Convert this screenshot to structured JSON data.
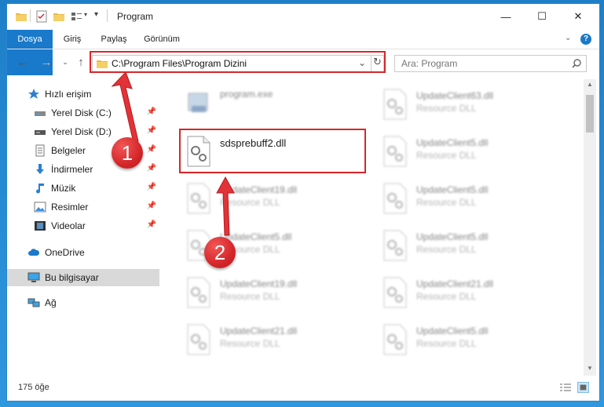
{
  "window": {
    "title": "Program",
    "controls": {
      "minimize": "—",
      "maximize": "☐",
      "close": "✕"
    }
  },
  "ribbon": {
    "tabs": [
      {
        "label": "Dosya",
        "active": true
      },
      {
        "label": "Giriş"
      },
      {
        "label": "Paylaş"
      },
      {
        "label": "Görünüm"
      }
    ],
    "help": "?"
  },
  "address_bar": {
    "path": "C:\\Program Files\\Program Dizini"
  },
  "search": {
    "placeholder": "Ara: Program"
  },
  "nav_pane": {
    "quick_access": "Hızlı erişim",
    "items": [
      {
        "label": "Yerel Disk (C:)",
        "icon": "drive-icon",
        "pinned": true
      },
      {
        "label": "Yerel Disk (D:)",
        "icon": "drive-icon",
        "pinned": true
      },
      {
        "label": "Belgeler",
        "icon": "documents-icon",
        "pinned": true
      },
      {
        "label": "İndirmeler",
        "icon": "downloads-icon",
        "pinned": true
      },
      {
        "label": "Müzik",
        "icon": "music-icon",
        "pinned": true
      },
      {
        "label": "Resimler",
        "icon": "pictures-icon",
        "pinned": true
      },
      {
        "label": "Videolar",
        "icon": "videos-icon",
        "pinned": true
      }
    ],
    "onedrive": "OneDrive",
    "this_pc": "Bu bilgisayar",
    "network": "Ağ"
  },
  "files": {
    "left_column": [
      {
        "name": "program.exe",
        "type": ""
      },
      {
        "name": "sdsprebuff2.dll",
        "type": ""
      },
      {
        "name": "UpdateClient19.dll",
        "type": "Resource DLL"
      },
      {
        "name": "UpdateClient5.dll",
        "type": "Resource DLL"
      },
      {
        "name": "UpdateClient19.dll",
        "type": "Resource DLL"
      },
      {
        "name": "UpdateClient21.dll",
        "type": "Resource DLL"
      }
    ],
    "right_column": [
      {
        "name": "UpdateClient63.dll",
        "type": "Resource DLL"
      },
      {
        "name": "UpdateClient5.dll",
        "type": "Resource DLL"
      },
      {
        "name": "UpdateClient5.dll",
        "type": "Resource DLL"
      },
      {
        "name": "UpdateClient5.dll",
        "type": "Resource DLL"
      },
      {
        "name": "UpdateClient21.dll",
        "type": "Resource DLL"
      },
      {
        "name": "UpdateClient5.dll",
        "type": "Resource DLL"
      }
    ]
  },
  "status_bar": {
    "item_count": "175 öğe"
  },
  "annotations": {
    "badge1": "1",
    "badge2": "2",
    "color": "#d9252a"
  },
  "colors": {
    "accent": "#1979ca",
    "selection": "#d9d9d9"
  }
}
